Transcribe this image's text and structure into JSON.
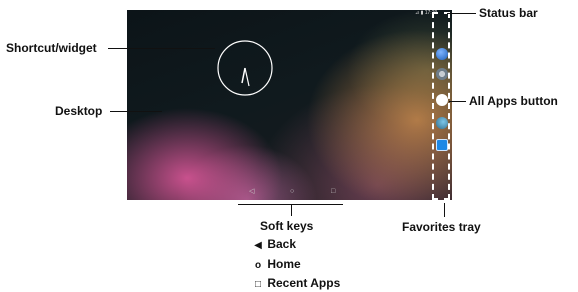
{
  "labels": {
    "shortcut": "Shortcut/widget",
    "desktop": "Desktop",
    "status_bar": "Status bar",
    "all_apps": "All Apps button",
    "favorites": "Favorites tray",
    "soft_keys": "Soft keys"
  },
  "soft_keys_legend": [
    {
      "icon": "back-triangle-icon",
      "label": "Back"
    },
    {
      "icon": "home-circle-icon",
      "label": "Home"
    },
    {
      "icon": "recent-square-icon",
      "label": "Recent Apps"
    }
  ],
  "screen": {
    "status_text": "17:29",
    "tray_icons": [
      "globe-icon",
      "settings-icon",
      "all-apps-icon",
      "browser-icon",
      "camera-icon"
    ],
    "nav_icons": [
      "back-triangle-icon",
      "home-circle-icon",
      "recent-square-icon"
    ],
    "colors": {
      "tray_border": "#ffffff",
      "all_apps_bg": "#ffffff",
      "camera_bg": "#1e88e5"
    }
  }
}
